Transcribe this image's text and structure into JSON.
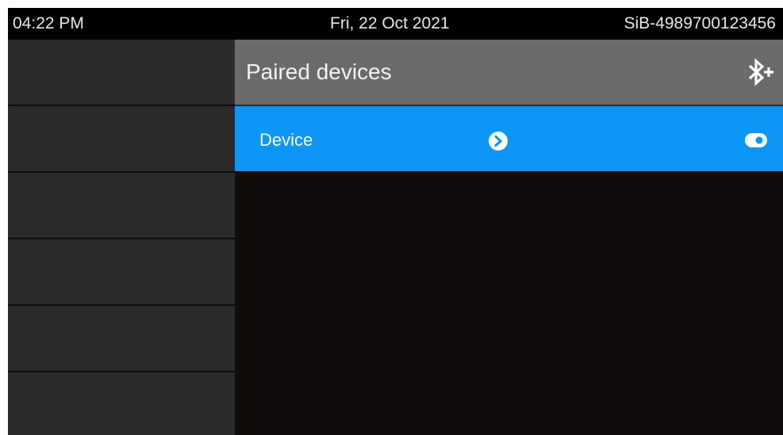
{
  "status_bar": {
    "time": "04:22 PM",
    "date": "Fri, 22 Oct 2021",
    "device_id": "SiB-4989700123456"
  },
  "header": {
    "title": "Paired devices",
    "action_icon": "bluetooth-add-icon"
  },
  "devices": [
    {
      "label": "Device",
      "details_icon": "chevron-right-circle-icon",
      "toggle_icon": "toggle-icon"
    }
  ],
  "colors": {
    "status_bar_bg": "#000000",
    "header_bg": "#6b6b6b",
    "selected_row_bg": "#0c96f6",
    "content_bg": "#130c0c",
    "left_panel_bg": "#2b2b2b"
  }
}
